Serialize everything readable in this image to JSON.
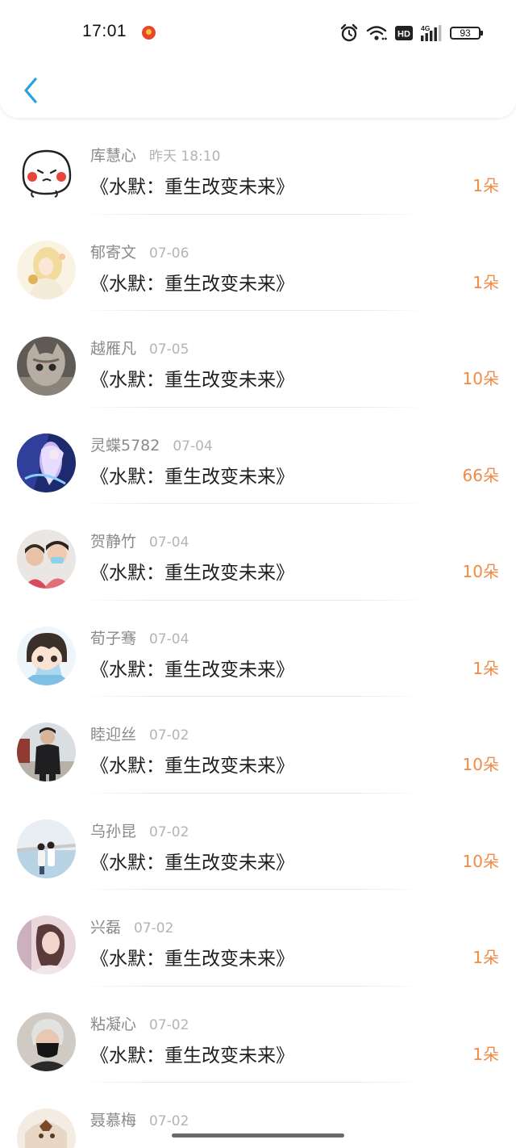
{
  "status_bar": {
    "time": "17:01",
    "battery": "93",
    "icons": [
      "alarm-icon",
      "wifi-icon",
      "hd-icon",
      "signal-4g-icon",
      "battery-icon"
    ]
  },
  "nav": {
    "back_icon": "chevron-left-icon",
    "accent": "#2a9fe0"
  },
  "list": {
    "items": [
      {
        "name": "库慧心",
        "date": "昨天 18:10",
        "book": "《水默：重生改变未来》",
        "count": "1朵"
      },
      {
        "name": "郁寄文",
        "date": "07-06",
        "book": "《水默：重生改变未来》",
        "count": "1朵"
      },
      {
        "name": "越雁凡",
        "date": "07-05",
        "book": "《水默：重生改变未来》",
        "count": "10朵"
      },
      {
        "name": "灵蝶5782",
        "date": "07-04",
        "book": "《水默：重生改变未来》",
        "count": "66朵"
      },
      {
        "name": "贺静竹",
        "date": "07-04",
        "book": "《水默：重生改变未来》",
        "count": "10朵"
      },
      {
        "name": "荀子骞",
        "date": "07-04",
        "book": "《水默：重生改变未来》",
        "count": "1朵"
      },
      {
        "name": "睦迎丝",
        "date": "07-02",
        "book": "《水默：重生改变未来》",
        "count": "10朵"
      },
      {
        "name": "乌孙昆",
        "date": "07-02",
        "book": "《水默：重生改变未来》",
        "count": "10朵"
      },
      {
        "name": "兴磊",
        "date": "07-02",
        "book": "《水默：重生改变未来》",
        "count": "1朵"
      },
      {
        "name": "粘凝心",
        "date": "07-02",
        "book": "《水默：重生改变未来》",
        "count": "1朵"
      },
      {
        "name": "聂慕梅",
        "date": "07-02",
        "book": "",
        "count": ""
      }
    ]
  },
  "colors": {
    "count": "#f08a45",
    "name": "#8a8a8a",
    "date": "#b4b4b4",
    "title": "#1e1e1e"
  }
}
